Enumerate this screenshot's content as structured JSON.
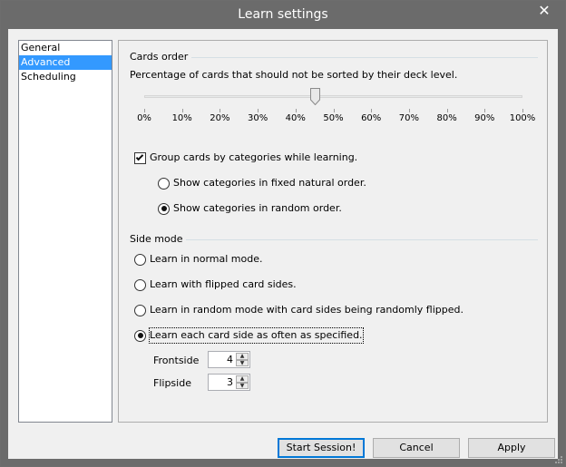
{
  "window": {
    "title": "Learn settings",
    "close_glyph": "✕"
  },
  "sidebar": {
    "items": [
      {
        "label": "General",
        "selected": false
      },
      {
        "label": "Advanced",
        "selected": true
      },
      {
        "label": "Scheduling",
        "selected": false
      }
    ]
  },
  "cards_order": {
    "title": "Cards order",
    "description": "Percentage of cards that should not be sorted by their deck level.",
    "slider": {
      "value_percent": 45,
      "ticks": [
        "0%",
        "10%",
        "20%",
        "30%",
        "40%",
        "50%",
        "60%",
        "70%",
        "80%",
        "90%",
        "100%"
      ]
    },
    "group_checkbox": {
      "label": "Group cards by categories while learning.",
      "checked": true
    },
    "category_options": [
      {
        "label": "Show categories in fixed natural order.",
        "selected": false
      },
      {
        "label": "Show categories in random order.",
        "selected": true
      }
    ]
  },
  "side_mode": {
    "title": "Side mode",
    "options": [
      {
        "label": "Learn in normal mode.",
        "selected": false
      },
      {
        "label": "Learn with flipped card sides.",
        "selected": false
      },
      {
        "label": "Learn in random mode with card sides being randomly flipped.",
        "selected": false
      },
      {
        "label": "Learn each card side as often as specified.",
        "selected": true
      }
    ],
    "frontside": {
      "label": "Frontside",
      "value": "4"
    },
    "flipside": {
      "label": "Flipside",
      "value": "3"
    }
  },
  "buttons": {
    "start": "Start Session!",
    "cancel": "Cancel",
    "apply": "Apply"
  },
  "colors": {
    "titlebar": "#6b6b6b",
    "selection": "#3399ff",
    "default_button_border": "#0078d7"
  }
}
